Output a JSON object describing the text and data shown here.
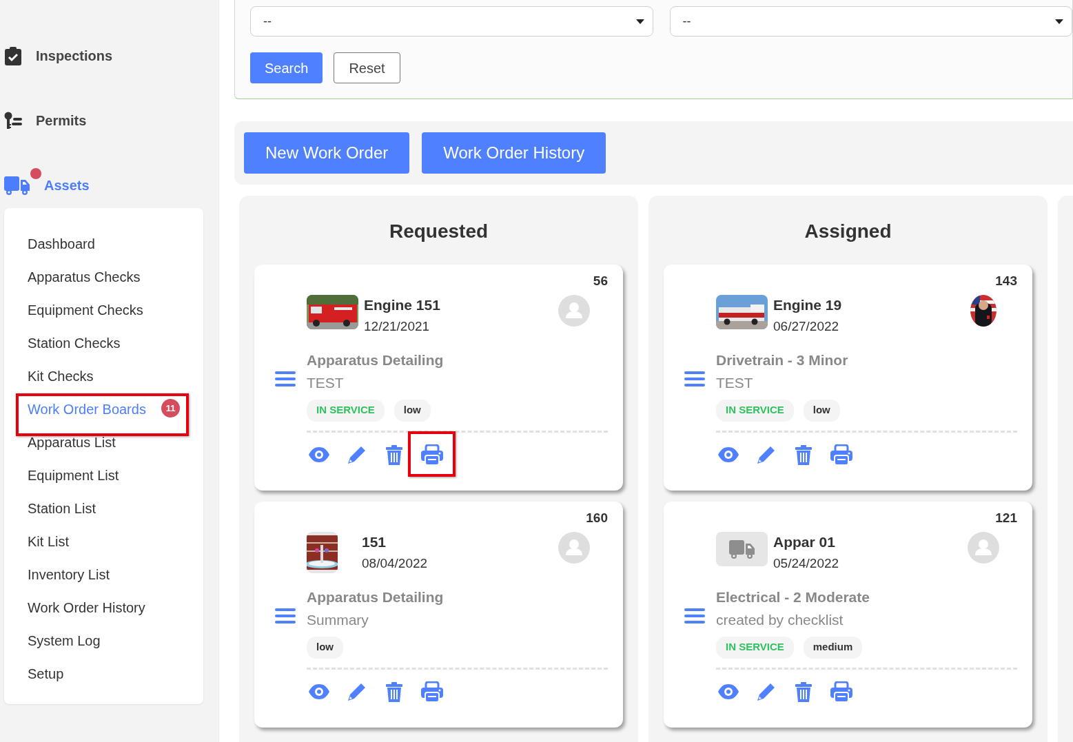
{
  "sidebar": {
    "sections": [
      {
        "label": "Inspections",
        "selected": false,
        "alert": false
      },
      {
        "label": "Permits",
        "selected": false,
        "alert": false
      },
      {
        "label": "Assets",
        "selected": true,
        "alert": true
      }
    ],
    "submenu": [
      {
        "label": "Dashboard",
        "selected": false,
        "highlighted": false
      },
      {
        "label": "Apparatus Checks",
        "selected": false,
        "highlighted": false
      },
      {
        "label": "Equipment Checks",
        "selected": false,
        "highlighted": false
      },
      {
        "label": "Station Checks",
        "selected": false,
        "highlighted": false
      },
      {
        "label": "Kit Checks",
        "selected": false,
        "highlighted": false
      },
      {
        "label": "Work Order Boards",
        "selected": true,
        "highlighted": true,
        "badge": "11"
      },
      {
        "label": "Apparatus List",
        "selected": false,
        "highlighted": false
      },
      {
        "label": "Equipment List",
        "selected": false,
        "highlighted": false
      },
      {
        "label": "Station List",
        "selected": false,
        "highlighted": false
      },
      {
        "label": "Kit List",
        "selected": false,
        "highlighted": false
      },
      {
        "label": "Inventory List",
        "selected": false,
        "highlighted": false
      },
      {
        "label": "Work Order History",
        "selected": false,
        "highlighted": false
      },
      {
        "label": "System Log",
        "selected": false,
        "highlighted": false
      },
      {
        "label": "Setup",
        "selected": false,
        "highlighted": false
      }
    ]
  },
  "filters": {
    "selects": [
      {
        "value": "--"
      },
      {
        "value": "--"
      }
    ],
    "buttons": [
      {
        "label": "Search",
        "kind": "primary"
      },
      {
        "label": "Reset",
        "kind": "outline"
      }
    ]
  },
  "toolbar": {
    "buttons": [
      "New Work Order",
      "Work Order History"
    ]
  },
  "columns": [
    {
      "title": "Requested",
      "cards": [
        {
          "number": "56",
          "name": "Engine 151",
          "date": "12/21/2021",
          "thumb": {
            "kind": "picture"
          },
          "assignee": {
            "kind": "placeholder"
          },
          "category": "Apparatus Detailing",
          "description": "TEST",
          "tags": [
            {
              "label": "IN SERVICE",
              "kind": "status"
            },
            {
              "label": "low",
              "kind": "priority"
            }
          ],
          "actions": [
            {
              "kind": "view",
              "highlighted": false
            },
            {
              "kind": "edit",
              "highlighted": false
            },
            {
              "kind": "delete",
              "highlighted": false
            },
            {
              "kind": "print",
              "highlighted": true
            }
          ]
        },
        {
          "number": "160",
          "name": "151",
          "date": "08/04/2022",
          "thumb": {
            "kind": "picture"
          },
          "assignee": {
            "kind": "placeholder"
          },
          "category": "Apparatus Detailing",
          "description": "Summary",
          "tags": [
            {
              "label": "low",
              "kind": "priority"
            }
          ],
          "actions": [
            {
              "kind": "view",
              "highlighted": false
            },
            {
              "kind": "edit",
              "highlighted": false
            },
            {
              "kind": "delete",
              "highlighted": false
            },
            {
              "kind": "print",
              "highlighted": false
            }
          ]
        }
      ]
    },
    {
      "title": "Assigned",
      "cards": [
        {
          "number": "143",
          "name": "Engine 19",
          "date": "06/27/2022",
          "thumb": {
            "kind": "picture"
          },
          "assignee": {
            "kind": "picture"
          },
          "category": "Drivetrain - 3 Minor",
          "description": "TEST",
          "tags": [
            {
              "label": "IN SERVICE",
              "kind": "status"
            },
            {
              "label": "low",
              "kind": "priority"
            }
          ],
          "actions": [
            {
              "kind": "view",
              "highlighted": false
            },
            {
              "kind": "edit",
              "highlighted": false
            },
            {
              "kind": "delete",
              "highlighted": false
            },
            {
              "kind": "print",
              "highlighted": false
            }
          ]
        },
        {
          "number": "121",
          "name": "Appar 01",
          "date": "05/24/2022",
          "thumb": {
            "kind": "placeholder"
          },
          "assignee": {
            "kind": "placeholder"
          },
          "category": "Electrical - 2 Moderate",
          "description": "created by checklist",
          "tags": [
            {
              "label": "IN SERVICE",
              "kind": "status"
            },
            {
              "label": "medium",
              "kind": "priority"
            }
          ],
          "actions": [
            {
              "kind": "view",
              "highlighted": false
            },
            {
              "kind": "edit",
              "highlighted": false
            },
            {
              "kind": "delete",
              "highlighted": false
            },
            {
              "kind": "print",
              "highlighted": false
            }
          ]
        }
      ]
    }
  ]
}
